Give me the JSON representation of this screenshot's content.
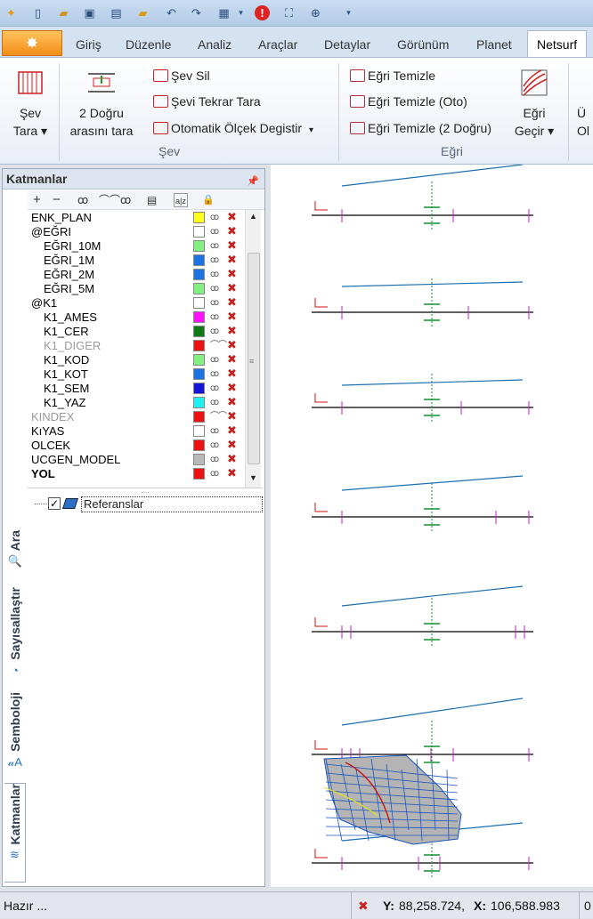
{
  "quick_access": {
    "icons": [
      "app-icon",
      "new-file-icon",
      "open-file-icon",
      "save-icon",
      "print-icon",
      "folder-icon",
      "undo-icon",
      "redo-icon",
      "window-icon",
      "dropdown-icon",
      "info-icon",
      "fit-extent-icon",
      "zoom-icon",
      "customize-icon"
    ]
  },
  "tabs": {
    "items": [
      "Giriş",
      "Düzenle",
      "Analiz",
      "Araçlar",
      "Detaylar",
      "Görünüm",
      "Planet",
      "Netsurf"
    ],
    "active": "Netsurf"
  },
  "ribbon": {
    "sev_tara": {
      "line1": "Şev",
      "line2": "Tara ▾"
    },
    "iki_dogru": {
      "line1": "2 Doğru",
      "line2": "arasını tara"
    },
    "sev_sil": "Şev Sil",
    "sevi_tekrar_tara": "Şevi Tekrar Tara",
    "otomatik_olcek": "Otomatik Ölçek Degistir",
    "egri_temizle": "Eğri Temizle",
    "egri_temizle_oto": "Eğri Temizle (Oto)",
    "egri_temizle_2": "Eğri Temizle (2 Doğru)",
    "egri_gecir": {
      "line1": "Eğri",
      "line2": "Geçir ▾"
    },
    "cut_next": {
      "line1": "Ü",
      "line2": "Ol"
    },
    "group_sev": "Şev",
    "group_egri": "Eğri"
  },
  "layers_panel": {
    "title": "Katmanlar",
    "toolbar": [
      "+",
      "−",
      "ꝏ",
      "⌒⌒",
      "ꝏ",
      "▤",
      "a|z",
      "🔒"
    ],
    "rows": [
      {
        "name": "ENK_PLAN",
        "indent": false,
        "style": "normal",
        "color": "#ffff1a",
        "visible": true
      },
      {
        "name": "@EĞRI",
        "indent": false,
        "style": "normal",
        "color": "#ffffff",
        "visible": true
      },
      {
        "name": "EĞRI_10M",
        "indent": true,
        "style": "normal",
        "color": "#80f080",
        "visible": true
      },
      {
        "name": "EĞRI_1M",
        "indent": true,
        "style": "normal",
        "color": "#1a73e0",
        "visible": true
      },
      {
        "name": "EĞRI_2M",
        "indent": true,
        "style": "normal",
        "color": "#1a73e0",
        "visible": true
      },
      {
        "name": "EĞRI_5M",
        "indent": true,
        "style": "normal",
        "color": "#80f080",
        "visible": true
      },
      {
        "name": "@K1",
        "indent": false,
        "style": "normal",
        "color": "#ffffff",
        "visible": true
      },
      {
        "name": "K1_AMES",
        "indent": true,
        "style": "normal",
        "color": "#ff10ff",
        "visible": true
      },
      {
        "name": "K1_CER",
        "indent": true,
        "style": "normal",
        "color": "#0b7a12",
        "visible": true
      },
      {
        "name": "K1_DIGER",
        "indent": true,
        "style": "dim",
        "color": "#ee1111",
        "visible": false
      },
      {
        "name": "K1_KOD",
        "indent": true,
        "style": "normal",
        "color": "#80f080",
        "visible": true
      },
      {
        "name": "K1_KOT",
        "indent": true,
        "style": "normal",
        "color": "#1a73e0",
        "visible": true
      },
      {
        "name": "K1_SEM",
        "indent": true,
        "style": "normal",
        "color": "#1515d8",
        "visible": true
      },
      {
        "name": "K1_YAZ",
        "indent": true,
        "style": "normal",
        "color": "#1ff0f0",
        "visible": true
      },
      {
        "name": "KINDEX",
        "indent": false,
        "style": "dim",
        "color": "#ee1111",
        "visible": false
      },
      {
        "name": "KıYAS",
        "indent": false,
        "style": "normal",
        "color": "#ffffff",
        "visible": true
      },
      {
        "name": "OLCEK",
        "indent": false,
        "style": "normal",
        "color": "#ee1111",
        "visible": true
      },
      {
        "name": "UCGEN_MODEL",
        "indent": false,
        "style": "normal",
        "color": "#b8b8b8",
        "visible": true
      },
      {
        "name": "YOL",
        "indent": false,
        "style": "bold",
        "color": "#ee1111",
        "visible": true
      }
    ],
    "reference_label": "Referanslar",
    "reference_checked": "✓",
    "splitter": "....",
    "eye_on": "ꝏ",
    "eye_off": "⌒⌒",
    "lock_glyph": "✖"
  },
  "side_tabs": [
    {
      "label": "Ara",
      "icon": "search-icon",
      "glyph": "🔍"
    },
    {
      "label": "Sayısallaştır",
      "icon": "digitize-icon",
      "glyph": "◔"
    },
    {
      "label": "Semboloji",
      "icon": "symbology-icon",
      "glyph": "𝒶A"
    },
    {
      "label": "Katmanlar",
      "icon": "layers-icon",
      "glyph": "≋"
    }
  ],
  "status_bar": {
    "ready": "Hazır ...",
    "y_label": "Y:",
    "y_value": "88,258.724,",
    "x_label": "X:",
    "x_value": "106,588.983",
    "trailing": "0"
  },
  "colors": {
    "profile_line": "#1a6fb0",
    "ground_line": "#000000",
    "magenta_tick": "#c020c0",
    "green_mark": "#109030",
    "red_mark": "#cc1111"
  }
}
